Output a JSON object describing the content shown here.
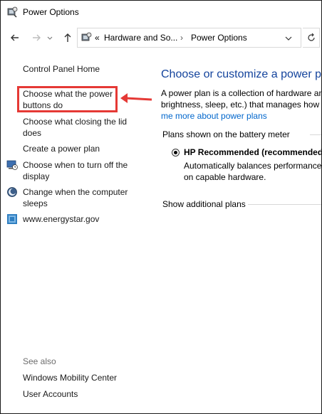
{
  "window": {
    "title": "Power Options",
    "icon": "power-options-icon"
  },
  "nav": {
    "back_icon": "arrow-left-icon",
    "forward_icon": "arrow-right-icon",
    "up_icon": "arrow-up-icon",
    "address_prefix": "«",
    "crumbs": [
      "Hardware and So...",
      "Power Options"
    ],
    "separator": "›",
    "dropdown_icon": "chevron-down-icon",
    "refresh_icon": "refresh-icon"
  },
  "sidebar": {
    "home": "Control Panel Home",
    "items": [
      {
        "label_line1": "Choose what the power",
        "label_line2": "buttons do",
        "icon": null
      },
      {
        "label_line1": "Choose what closing the lid",
        "label_line2": "does",
        "icon": null
      },
      {
        "label_line1": "Create a power plan",
        "label_line2": "",
        "icon": null
      },
      {
        "label_line1": "Choose when to turn off the",
        "label_line2": "display",
        "icon": "display-schedule-icon"
      },
      {
        "label_line1": "Change when the computer",
        "label_line2": "sleeps",
        "icon": "sleep-moon-icon"
      },
      {
        "label_line1": "www.energystar.gov",
        "label_line2": "",
        "icon": "energystar-icon"
      }
    ],
    "see_also": "See also",
    "see_also_links": [
      "Windows Mobility Center",
      "User Accounts"
    ]
  },
  "main": {
    "heading": "Choose or customize a power pla",
    "desc_line1": "A power plan is a collection of hardware an",
    "desc_line2": "brightness, sleep, etc.) that manages how y",
    "learn_more": "me more about power plans",
    "plans_label": "Plans shown on the battery meter",
    "plan_name": "HP Recommended (recommended)",
    "plan_desc_line1": "Automatically balances performance",
    "plan_desc_line2": "on capable hardware.",
    "show_additional": "Show additional plans"
  },
  "colors": {
    "link": "#1a1a1a",
    "heading": "#13439c",
    "highlight": "#e53935"
  }
}
